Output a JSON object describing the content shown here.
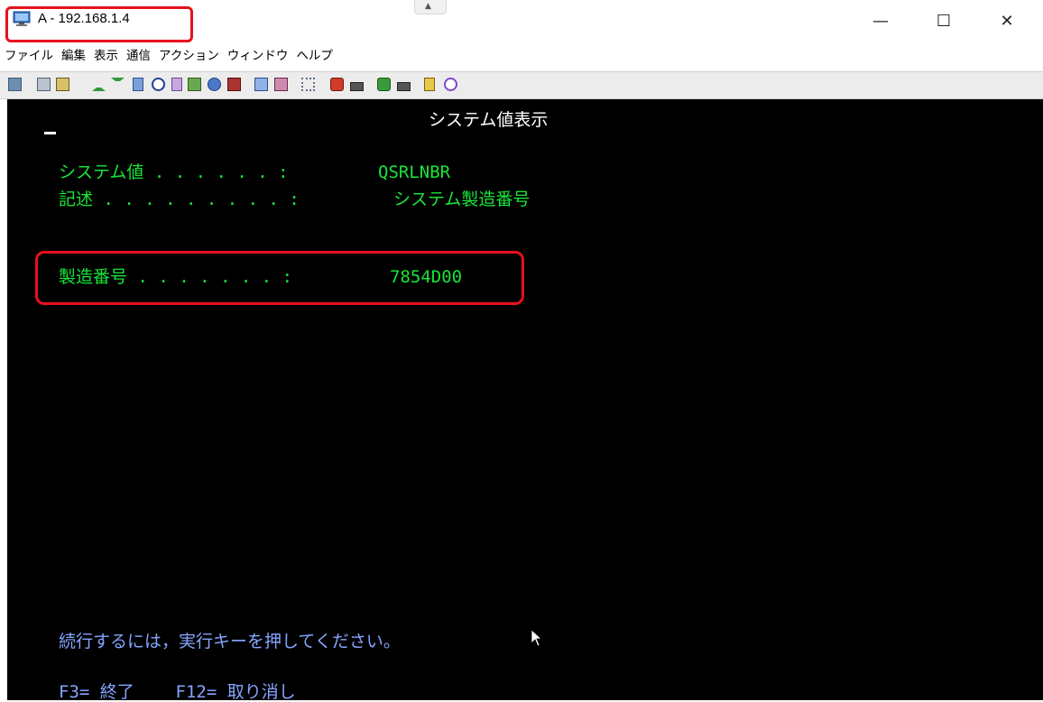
{
  "window": {
    "title": "A - 192.168.1.4",
    "minimize_glyph": "—",
    "maximize_glyph": "☐",
    "close_glyph": "✕"
  },
  "menu": {
    "items": [
      "ファイル",
      "編集",
      "表示",
      "通信",
      "アクション",
      "ウィンドウ",
      "ヘルプ"
    ]
  },
  "toolbar": {
    "icons": [
      "copy-icon",
      "paste-icon",
      "paste-special-icon",
      "send-file-icon",
      "receive-file-icon",
      "document-icon",
      "clock-icon",
      "macro-icon",
      "print-icon",
      "printer-setup-icon",
      "screen-icon",
      "display-icon",
      "keyboard-icon",
      "tools-icon",
      "send-icon",
      "receive-icon",
      "send2-icon",
      "receive2-icon",
      "notes-icon",
      "help-icon"
    ]
  },
  "screen": {
    "heading": "システム値表示",
    "rows": [
      {
        "label": "システム値 . . . . . . :",
        "value": "QSRLNBR"
      },
      {
        "label": "記述 . . . . . . . . . :",
        "value": "システム製造番号"
      },
      {
        "label": "製造番号 . . . . . . . :",
        "value": "7854D00"
      }
    ],
    "prompt": "続行するには，実行キーを押してください。",
    "fkeys": "F3= 終了    F12= 取り消し"
  },
  "colors": {
    "terminal_bg": "#000000",
    "heading_text": "#ffffff",
    "field_text": "#19e53a",
    "prompt_text": "#85a5ff",
    "highlight": "#e8101c"
  }
}
